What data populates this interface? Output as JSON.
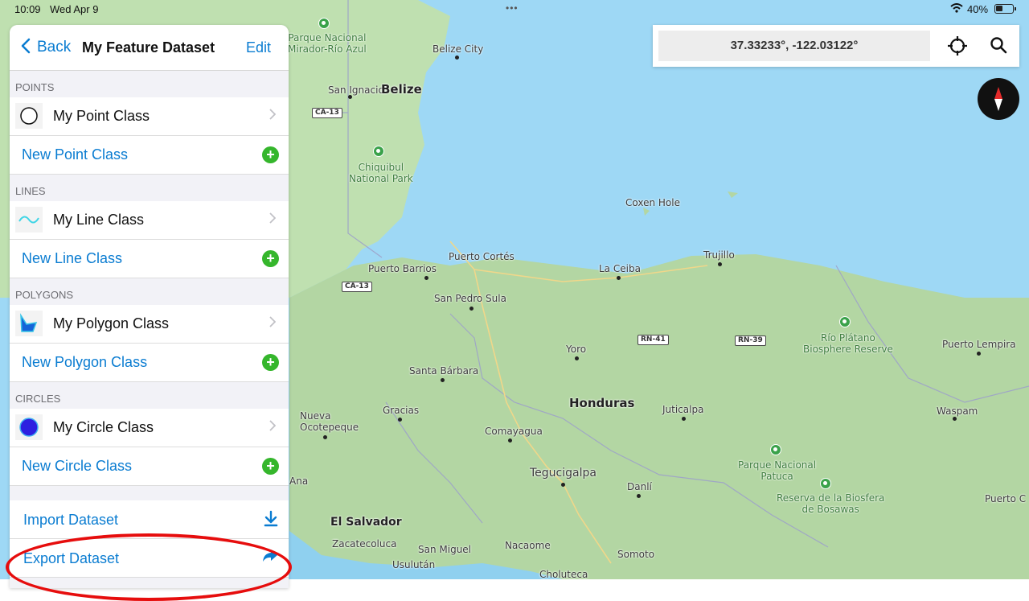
{
  "status_bar": {
    "time": "10:09",
    "date": "Wed Apr 9",
    "multitask": "•••",
    "battery": "40%"
  },
  "map": {
    "places": {
      "parque_mirador": "Parque Nacional\nMirador-Río Azul",
      "belize_city": "Belize City",
      "san_ignacio": "San Ignacio",
      "belize": "Belize",
      "chiquibul": "Chiquibul\nNational Park",
      "coxen_hole": "Coxen Hole",
      "puerto_barrios": "Puerto Barrios",
      "puerto_cortes": "Puerto Cortés",
      "la_ceiba": "La Ceiba",
      "trujillo": "Trujillo",
      "san_pedro_sula": "San Pedro Sula",
      "rio_platano": "Río Plátano\nBiosphere Reserve",
      "puerto_lempira": "Puerto Lempira",
      "yoro": "Yoro",
      "santa_barbara": "Santa Bárbara",
      "honduras": "Honduras",
      "gracias": "Gracias",
      "juticalpa": "Juticalpa",
      "nueva_ocotepeque": "Nueva\nOcotepeque",
      "comayagua": "Comayagua",
      "waspam": "Waspam",
      "parque_patuca": "Parque Nacional\nPatuca",
      "tegucigalpa": "Tegucigalpa",
      "danli": "Danlí",
      "reserva_bosawas": "Reserva de la Biosfera\nde Bosawas",
      "el_salvador": "El Salvador",
      "zacatecoluca": "Zacatecoluca",
      "san_miguel": "San Miguel",
      "nacaome": "Nacaome",
      "somoto": "Somoto",
      "usulutan": "Usulután",
      "choluteca": "Choluteca",
      "ana": "Ana",
      "puerto_c": "Puerto C"
    },
    "shields": {
      "ca13_north": "CA-13",
      "ca13_south": "CA-13",
      "rn41": "RN-41",
      "rn39": "RN-39"
    }
  },
  "panel": {
    "back_label": "Back",
    "title": "My Feature Dataset",
    "edit_label": "Edit",
    "sections": {
      "points": {
        "header": "POINTS",
        "item": "My Point Class",
        "new": "New Point Class"
      },
      "lines": {
        "header": "LINES",
        "item": "My Line Class",
        "new": "New Line Class"
      },
      "polygons": {
        "header": "POLYGONS",
        "item": "My Polygon Class",
        "new": "New Polygon Class"
      },
      "circles": {
        "header": "CIRCLES",
        "item": "My Circle Class",
        "new": "New Circle Class"
      }
    },
    "import_label": "Import Dataset",
    "export_label": "Export Dataset"
  },
  "coords": {
    "value": "37.33233°, -122.03122°"
  },
  "colors": {
    "accent": "#0a7cd1",
    "add_green": "#35b62c",
    "highlight_red": "#e60d0d",
    "circle_fill": "#2d1fe0"
  }
}
